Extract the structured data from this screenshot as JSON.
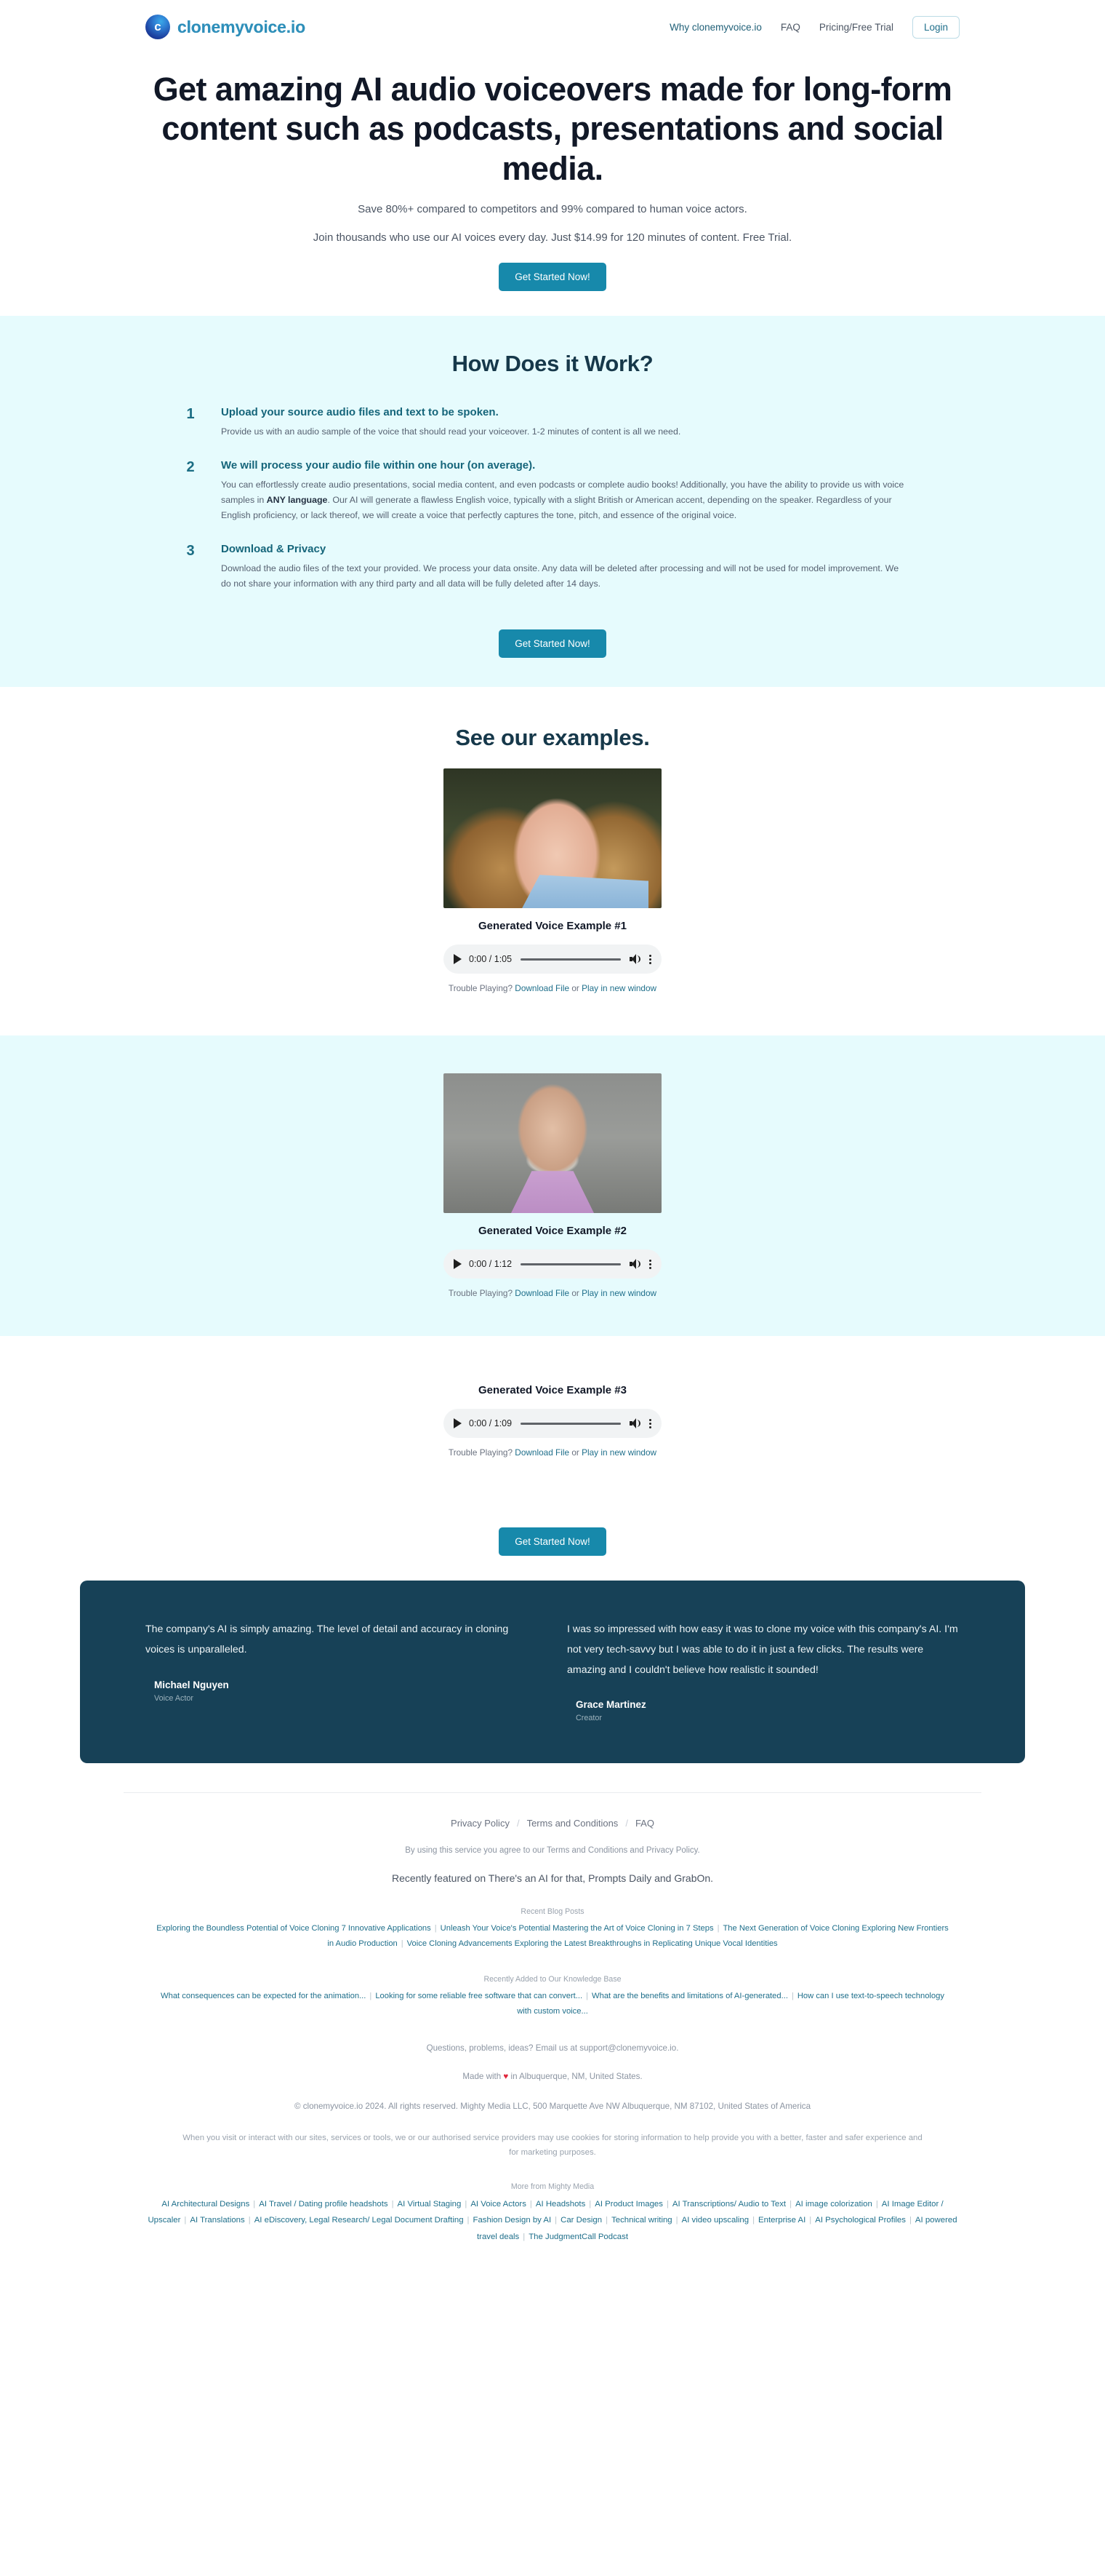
{
  "header": {
    "brand_name": "clonemyvoice.io",
    "nav": [
      {
        "label": "Why clonemyvoice.io"
      },
      {
        "label": "FAQ"
      },
      {
        "label": "Pricing/Free Trial"
      }
    ],
    "login_label": "Login"
  },
  "hero": {
    "headline": "Get amazing AI audio voiceovers made for long-form content such as podcasts, presentations and social media.",
    "sub1": "Save 80%+ compared to competitors and 99% compared to human voice actors.",
    "sub2": "Join thousands who use our AI voices every day. Just $14.99 for 120 minutes of content. Free Trial.",
    "cta_label": "Get Started Now!"
  },
  "how": {
    "title": "How Does it Work?",
    "steps": [
      {
        "num": "1",
        "title": "Upload your source audio files and text to be spoken.",
        "text_before": "Provide us with an audio sample of the voice that should read your voiceover. 1-2 minutes of content is all we need.",
        "bold": "",
        "text_after": ""
      },
      {
        "num": "2",
        "title": "We will process your audio file within one hour (on average).",
        "text_before": "You can effortlessly create audio presentations, social media content, and even podcasts or complete audio books! Additionally, you have the ability to provide us with voice samples in ",
        "bold": "ANY language",
        "text_after": ". Our AI will generate a flawless English voice, typically with a slight British or American accent, depending on the speaker. Regardless of your English proficiency, or lack thereof, we will create a voice that perfectly captures the tone, pitch, and essence of the original voice."
      },
      {
        "num": "3",
        "title": "Download & Privacy",
        "text_before": "Download the audio files of the text your provided. We process your data onsite. Any data will be deleted after processing and will not be used for model improvement. We do not share your information with any third party and all data will be fully deleted after 14 days.",
        "bold": "",
        "text_after": ""
      }
    ],
    "cta_label": "Get Started Now!"
  },
  "examples": {
    "title": "See our examples.",
    "items": [
      {
        "label": "Generated Voice Example #1",
        "time": "0:00 / 1:05",
        "trouble_prefix": "Trouble Playing? ",
        "download_label": "Download File",
        "or_label": " or ",
        "newwindow_label": "Play in new window"
      },
      {
        "label": "Generated Voice Example #2",
        "time": "0:00 / 1:12",
        "trouble_prefix": "Trouble Playing? ",
        "download_label": "Download File",
        "or_label": " or ",
        "newwindow_label": "Play in new window"
      },
      {
        "label": "Generated Voice Example #3",
        "time": "0:00 / 1:09",
        "trouble_prefix": "Trouble Playing? ",
        "download_label": "Download File",
        "or_label": " or ",
        "newwindow_label": "Play in new window"
      }
    ],
    "cta_label": "Get Started Now!"
  },
  "testimonials": [
    {
      "quote": "The company's AI is simply amazing. The level of detail and accuracy in cloning voices is unparalleled.",
      "name": "Michael Nguyen",
      "role": "Voice Actor"
    },
    {
      "quote": "I was so impressed with how easy it was to clone my voice with this company's AI. I'm not very tech-savvy but I was able to do it in just a few clicks. The results were amazing and I couldn't believe how realistic it sounded!",
      "name": "Grace Martinez",
      "role": "Creator"
    }
  ],
  "footer": {
    "links": [
      {
        "label": "Privacy Policy"
      },
      {
        "label": "Terms and Conditions"
      },
      {
        "label": "FAQ"
      }
    ],
    "agree": "By using this service you agree to our Terms and Conditions and Privacy Policy.",
    "featured": "Recently featured on There's an AI for that, Prompts Daily and GrabOn.",
    "blog_title": "Recent Blog Posts",
    "blog_links": [
      "Exploring the Boundless Potential of Voice Cloning 7 Innovative Applications",
      "Unleash Your Voice's Potential Mastering the Art of Voice Cloning in 7 Steps",
      "The Next Generation of Voice Cloning Exploring New Frontiers in Audio Production",
      "Voice Cloning Advancements Exploring the Latest Breakthroughs in Replicating Unique Vocal Identities"
    ],
    "kb_title": "Recently Added to Our Knowledge Base",
    "kb_links": [
      "What consequences can be expected for the animation...",
      "Looking for some reliable free software that can convert...",
      "What are the benefits and limitations of AI-generated...",
      "How can I use text-to-speech technology with custom voice..."
    ],
    "support": "Questions, problems, ideas? Email us at support@clonemyvoice.io.",
    "made_prefix": "Made with ",
    "made_heart": "♥",
    "made_suffix": " in Albuquerque, NM, United States.",
    "copyright": "© clonemyvoice.io 2024. All rights reserved. Mighty Media LLC, 500 Marquette Ave NW Albuquerque, NM 87102, United States of America",
    "cookie": "When you visit or interact with our sites, services or tools, we or our authorised service providers may use cookies for storing information to help provide you with a better, faster and safer experience and for marketing purposes.",
    "more_title": "More from Mighty Media",
    "more_links": [
      "AI Architectural Designs",
      "AI Travel / Dating profile headshots",
      "AI Virtual Staging",
      "AI Voice Actors",
      "AI Headshots",
      "AI Product Images",
      "AI Transcriptions/ Audio to Text",
      "AI image colorization",
      "AI Image Editor / Upscaler",
      "AI Translations",
      "AI eDiscovery, Legal Research/ Legal Document Drafting",
      "Fashion Design by AI",
      "Car Design",
      "Technical writing",
      "AI video upscaling",
      "Enterprise AI",
      "AI Psychological Profiles",
      "AI powered travel deals",
      "The JudgmentCall Podcast"
    ]
  },
  "colors": {
    "accent": "#1789ab",
    "brand_dark": "#16384a",
    "band_cyan": "#e6fbfd",
    "testimonial_bg": "#174157",
    "link": "#1f6f8b"
  }
}
